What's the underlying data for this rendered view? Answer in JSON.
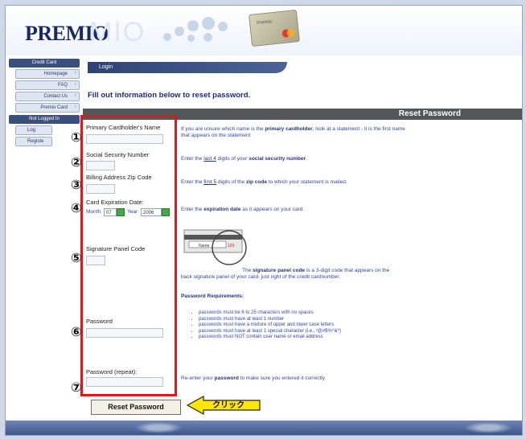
{
  "brand": {
    "logo": "PREMIO",
    "logo_ghost": "MIO",
    "card_text": "Premio"
  },
  "sidebar": {
    "section1": "Credit Card",
    "items": [
      "Homepage",
      "FAQ",
      "Contact Us",
      "Premio Card"
    ],
    "section2": "Not Logged In",
    "stubs": [
      "Log",
      "Registe"
    ]
  },
  "tab": {
    "label": "Login"
  },
  "intro": "Fill out information below to reset password.",
  "reset_header": "Reset Password",
  "fields": [
    {
      "num": "①",
      "label": "Primary Cardholder's Name",
      "info_pre": "If you are unsure which name is the ",
      "info_bold": "primary cardholder",
      "info_post": ", look at a statement - it is the first name that appears on the statement"
    },
    {
      "num": "②",
      "label": "Social Security Number",
      "info_pre": "Enter the ",
      "info_u": "last 4",
      "info_mid": " digits of your ",
      "info_bold": "social security number",
      "info_post": "."
    },
    {
      "num": "③",
      "label": "Billing Address Zip Code",
      "info_pre": "Enter the ",
      "info_u": "first 5",
      "info_mid": " digits of the ",
      "info_bold": "zip code",
      "info_post": " to which your statement is mailed."
    },
    {
      "num": "④",
      "label": "Card Expiration Date:",
      "info_pre": "Enter the ",
      "info_bold": "expiration date",
      "info_post": " as it appears on your card."
    },
    {
      "num": "⑤",
      "label": "Signature Panel Code",
      "info_pre": "The ",
      "info_bold": "signature panel code",
      "info_post": " is a 3-digit code that appears on the back signature panel of your card, just right of the credit cardnumber."
    },
    {
      "num": "⑥",
      "label": "Password"
    },
    {
      "num": "⑦",
      "label": "Password (repeat):",
      "info_pre": "Re-enter your ",
      "info_bold": "password",
      "info_post": " to make sure you entered it correctly."
    }
  ],
  "expiration": {
    "month_label": "Month",
    "month_value": "07",
    "year_label": "Year",
    "year_value": "2006"
  },
  "sig_sample": {
    "name": "Name",
    "code": "123"
  },
  "password_req": {
    "title": "Password Requirements:",
    "items": [
      "passwords must be 6 to 25 characters with no spaces",
      "passwords must have at least 1 number",
      "passwords must have a mixture of upper and lower case letters",
      "passwords must have at least 1 special character (i.e., !@#$%^&*)",
      "passwords must NOT contain user name or email address"
    ]
  },
  "button": {
    "reset": "Reset Password"
  },
  "callout": {
    "click": "クリック"
  },
  "colors": {
    "highlight": "#e0181d",
    "callout_fill": "#ffe600",
    "header_band": "#55565a",
    "link_blue": "#3346a0"
  }
}
